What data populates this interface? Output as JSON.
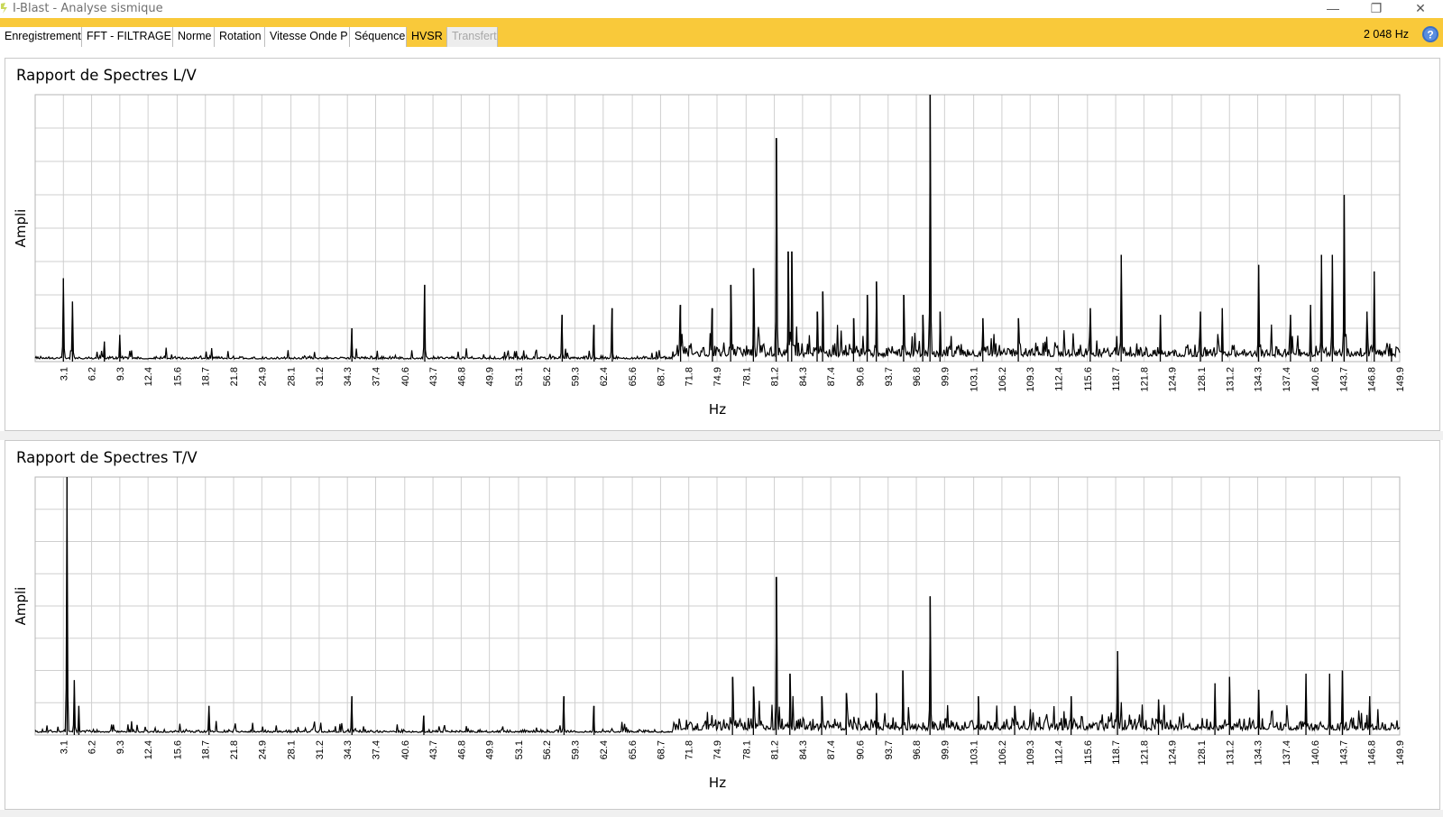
{
  "window": {
    "title": "I-Blast - Analyse sismique",
    "minimize": "—",
    "restore": "❐",
    "close": "✕"
  },
  "tabs": [
    {
      "label": "Enregistrement",
      "state": "normal"
    },
    {
      "label": "FFT - FILTRAGE",
      "state": "normal"
    },
    {
      "label": "Norme",
      "state": "normal"
    },
    {
      "label": "Rotation",
      "state": "normal"
    },
    {
      "label": "Vitesse Onde P",
      "state": "normal"
    },
    {
      "label": "Séquence",
      "state": "normal"
    },
    {
      "label": "HVSR",
      "state": "active"
    },
    {
      "label": "Transfert",
      "state": "disabled"
    }
  ],
  "toolbar": {
    "frequency": "2 048 Hz",
    "help_icon": "help-icon"
  },
  "colors": {
    "accent": "#f9c93a",
    "grid": "#cfcfcf",
    "line": "#000000"
  },
  "panels": [
    {
      "title_prefix": "Rapport de Spectres",
      "title_suffix": "L/V"
    },
    {
      "title_prefix": "Rapport de Spectres",
      "title_suffix": "T/V"
    }
  ],
  "chart_data": [
    {
      "type": "line",
      "title": "Rapport de Spectres L/V",
      "xlabel": "Hz",
      "ylabel": "Ampli",
      "xlim": [
        0,
        149.9
      ],
      "ylim": [
        0,
        8
      ],
      "grid": true,
      "x_tick_labels": [
        "3.1",
        "6.2",
        "9.3",
        "12.4",
        "15.6",
        "18.7",
        "21.8",
        "24.9",
        "28.1",
        "31.2",
        "34.3",
        "37.4",
        "40.6",
        "43.7",
        "46.8",
        "49.9",
        "53.1",
        "56.2",
        "59.3",
        "62.4",
        "65.6",
        "68.7",
        "71.8",
        "74.9",
        "78.1",
        "81.2",
        "84.3",
        "87.4",
        "90.6",
        "93.7",
        "96.8",
        "99.9",
        "103.1",
        "106.2",
        "109.3",
        "112.4",
        "115.6",
        "118.7",
        "121.8",
        "124.9",
        "128.1",
        "131.2",
        "134.3",
        "137.4",
        "140.6",
        "143.7",
        "146.8",
        "149.9"
      ],
      "peaks": [
        [
          3.1,
          2.5
        ],
        [
          4.1,
          1.8
        ],
        [
          7.6,
          0.6
        ],
        [
          9.3,
          0.8
        ],
        [
          34.8,
          1.0
        ],
        [
          42.8,
          2.3
        ],
        [
          57.9,
          1.4
        ],
        [
          61.4,
          1.1
        ],
        [
          63.4,
          1.6
        ],
        [
          70.9,
          1.7
        ],
        [
          74.4,
          1.6
        ],
        [
          76.4,
          2.3
        ],
        [
          78.9,
          2.8
        ],
        [
          81.4,
          6.7
        ],
        [
          82.7,
          3.3
        ],
        [
          83.1,
          3.3
        ],
        [
          85.9,
          1.5
        ],
        [
          86.5,
          2.1
        ],
        [
          89.9,
          1.3
        ],
        [
          91.4,
          2.0
        ],
        [
          92.4,
          2.4
        ],
        [
          95.4,
          2.0
        ],
        [
          97.5,
          1.4
        ],
        [
          98.3,
          8.0
        ],
        [
          99.4,
          1.5
        ],
        [
          104.1,
          1.3
        ],
        [
          108.0,
          1.3
        ],
        [
          115.9,
          1.6
        ],
        [
          119.3,
          3.2
        ],
        [
          123.6,
          1.4
        ],
        [
          128.0,
          1.5
        ],
        [
          130.4,
          1.6
        ],
        [
          134.4,
          2.9
        ],
        [
          137.9,
          1.4
        ],
        [
          140.1,
          1.7
        ],
        [
          141.3,
          3.2
        ],
        [
          142.5,
          3.2
        ],
        [
          143.8,
          5.0
        ],
        [
          146.3,
          1.5
        ],
        [
          147.1,
          2.7
        ],
        [
          149.0,
          0.4
        ]
      ]
    },
    {
      "type": "line",
      "title": "Rapport de Spectres T/V",
      "xlabel": "Hz",
      "ylabel": "Ampli",
      "xlim": [
        0,
        149.9
      ],
      "ylim": [
        0,
        8
      ],
      "grid": true,
      "x_tick_labels": [
        "3.1",
        "6.2",
        "9.3",
        "12.4",
        "15.6",
        "18.7",
        "21.8",
        "24.9",
        "28.1",
        "31.2",
        "34.3",
        "37.4",
        "40.6",
        "43.7",
        "46.8",
        "49.9",
        "53.1",
        "56.2",
        "59.3",
        "62.4",
        "65.6",
        "68.7",
        "71.8",
        "74.9",
        "78.1",
        "81.2",
        "84.3",
        "87.4",
        "90.6",
        "93.7",
        "96.8",
        "99.9",
        "103.1",
        "106.2",
        "109.3",
        "112.4",
        "115.6",
        "118.7",
        "121.8",
        "124.9",
        "128.1",
        "131.2",
        "134.3",
        "137.4",
        "140.6",
        "143.7",
        "146.8",
        "149.9"
      ],
      "peaks": [
        [
          3.5,
          8.0
        ],
        [
          4.3,
          1.7
        ],
        [
          4.8,
          0.9
        ],
        [
          19.1,
          0.9
        ],
        [
          34.8,
          1.2
        ],
        [
          42.7,
          0.6
        ],
        [
          58.1,
          1.2
        ],
        [
          61.4,
          0.9
        ],
        [
          76.6,
          1.8
        ],
        [
          78.9,
          1.5
        ],
        [
          81.4,
          4.9
        ],
        [
          82.9,
          1.9
        ],
        [
          86.4,
          1.2
        ],
        [
          89.1,
          1.3
        ],
        [
          92.4,
          1.3
        ],
        [
          95.3,
          2.0
        ],
        [
          98.3,
          4.3
        ],
        [
          103.6,
          1.2
        ],
        [
          107.6,
          0.9
        ],
        [
          113.8,
          1.2
        ],
        [
          118.9,
          2.6
        ],
        [
          123.4,
          1.1
        ],
        [
          129.6,
          1.6
        ],
        [
          131.2,
          1.8
        ],
        [
          134.4,
          1.4
        ],
        [
          139.6,
          1.9
        ],
        [
          142.2,
          1.9
        ],
        [
          143.6,
          2.0
        ],
        [
          146.6,
          1.2
        ]
      ]
    }
  ]
}
